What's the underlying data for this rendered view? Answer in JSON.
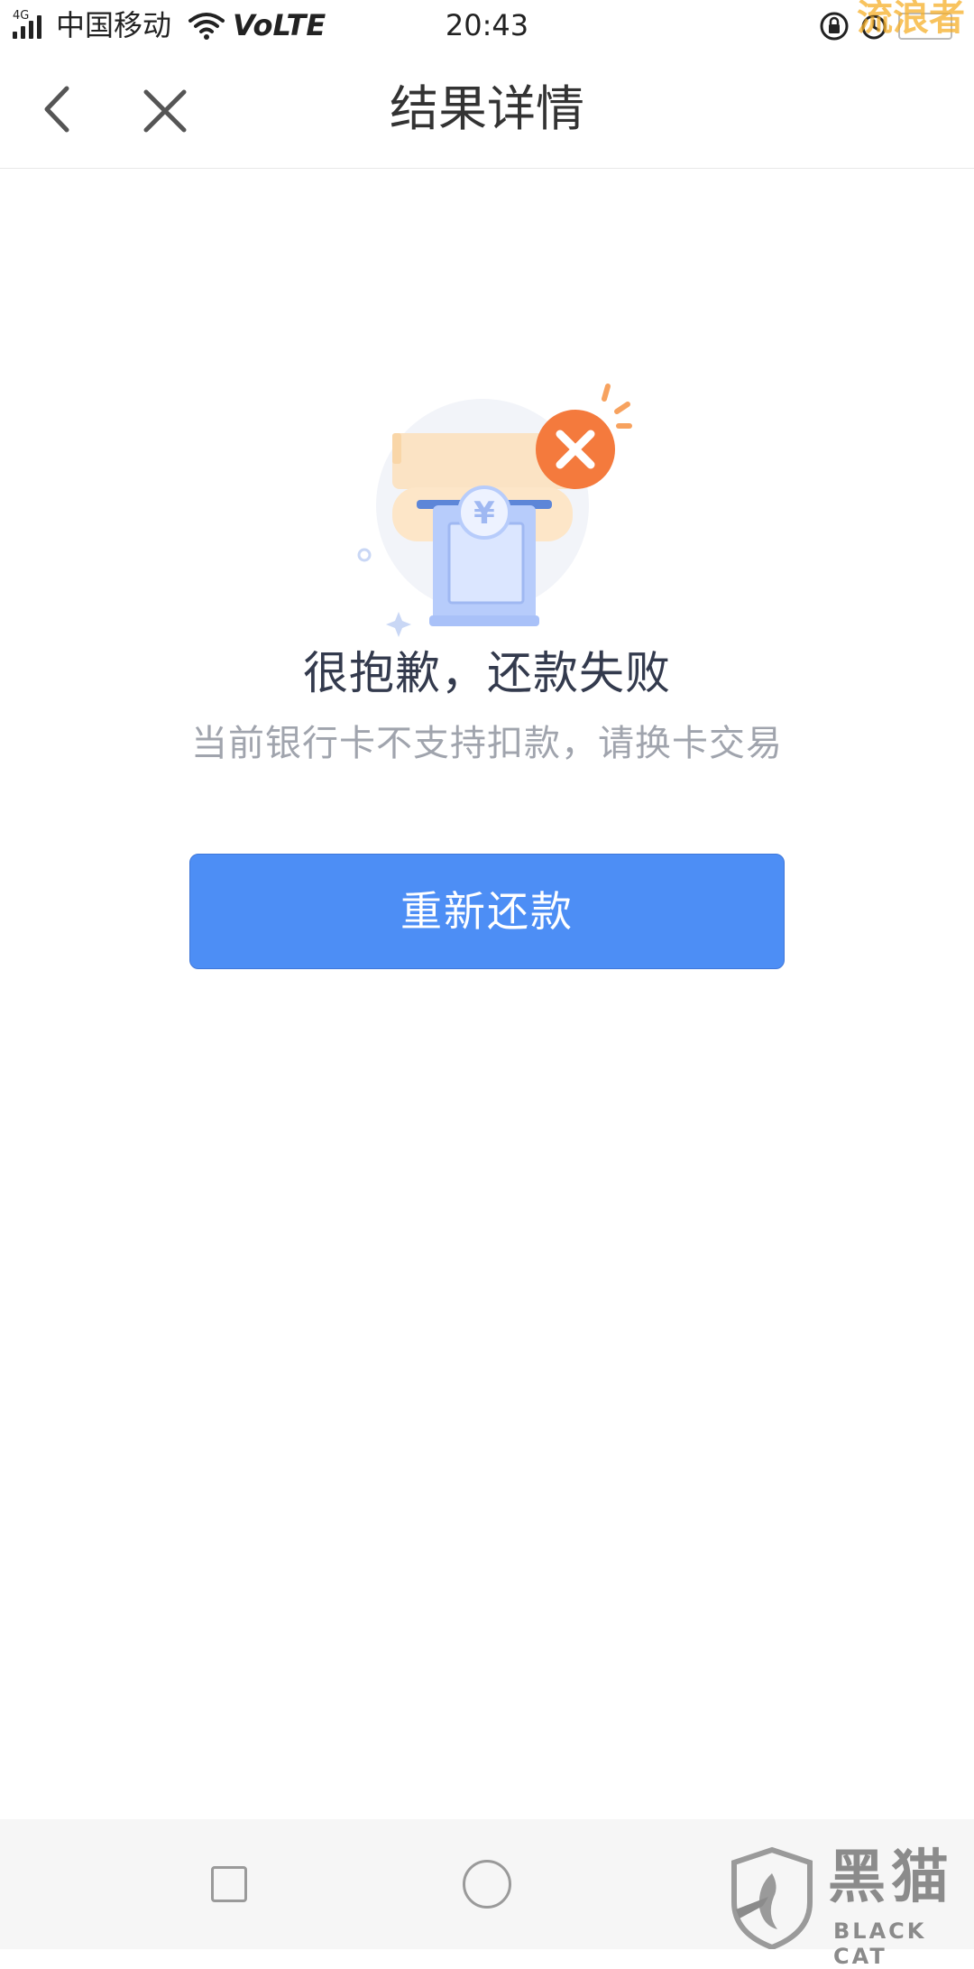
{
  "status_bar": {
    "network": "4G",
    "carrier": "中国移动",
    "volte": "VoLTE",
    "time": "20:43",
    "watermark": "流浪者"
  },
  "nav": {
    "title": "结果详情"
  },
  "result": {
    "title": "很抱歉，还款失败",
    "subtitle": "当前银行卡不支持扣款，请换卡交易",
    "currency_symbol": "¥"
  },
  "actions": {
    "retry_label": "重新还款"
  },
  "brand_watermark": {
    "name_cn": "黑猫",
    "name_en": "BLACK CAT"
  },
  "colors": {
    "primary_button": "#4d8ef5",
    "error_badge": "#f47a3d",
    "title_text": "#333a4d",
    "subtitle_text": "#a0a4ad"
  }
}
